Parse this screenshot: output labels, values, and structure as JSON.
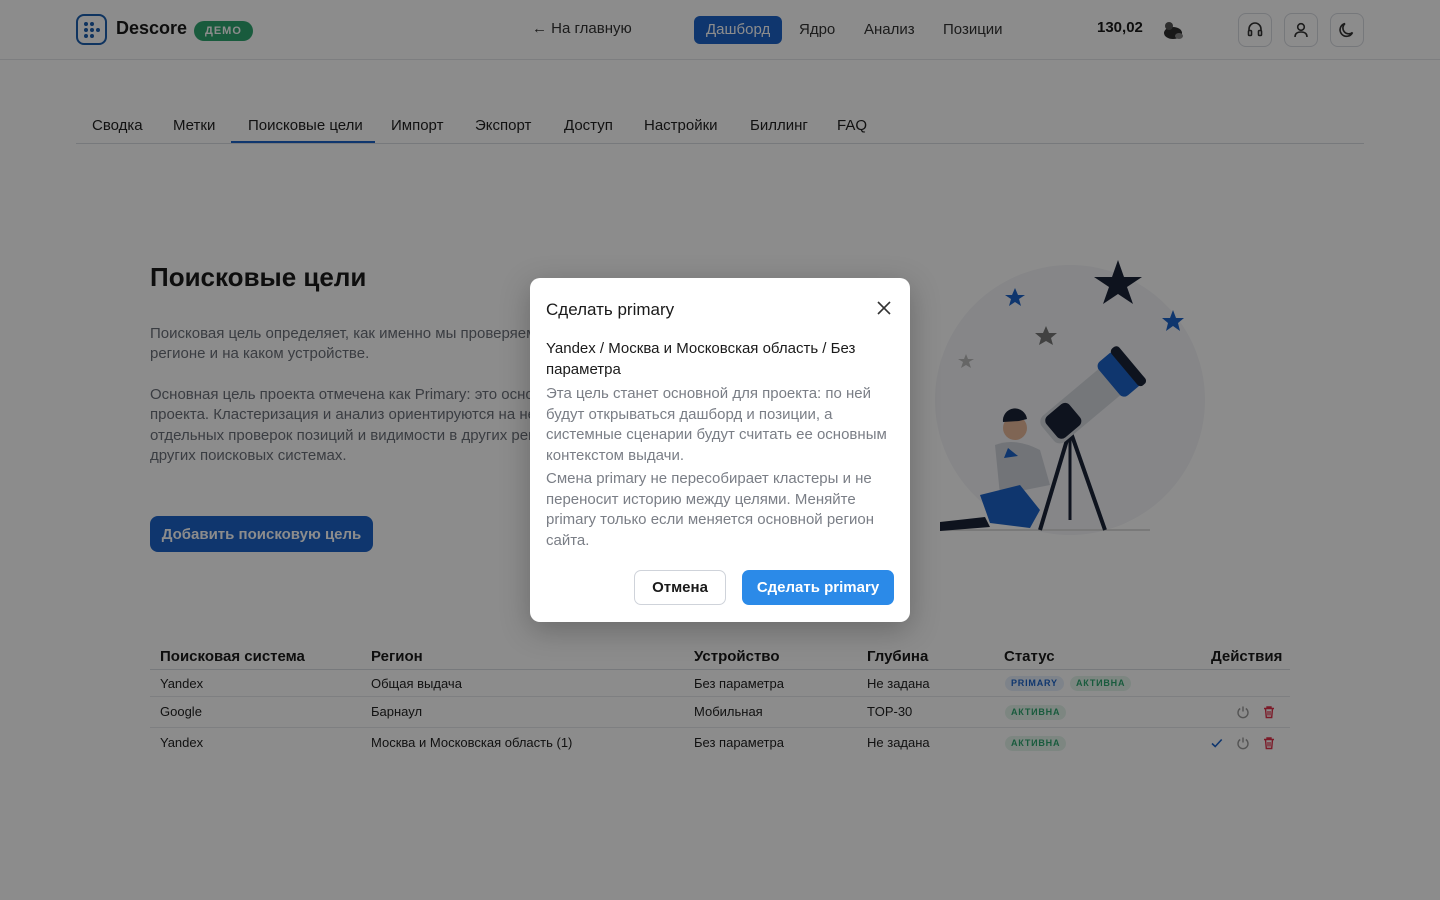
{
  "header": {
    "brand": "Descore",
    "demo_badge": "ДЕМО",
    "back_link": "← На главную",
    "nav": [
      "Дашборд",
      "Ядро",
      "Анализ",
      "Позиции"
    ],
    "balance": "130,02"
  },
  "tabs": [
    "Сводка",
    "Метки",
    "Поисковые цели",
    "Импорт",
    "Экспорт",
    "Доступ",
    "Настройки",
    "Биллинг",
    "FAQ"
  ],
  "hero": {
    "title": "Поисковые цели",
    "desc1_line1": "Поисковая цель определяет, как именно мы проверяем",
    "desc1_line2": "регионе и на каком устройстве.",
    "desc2_line1": "Основная цель проекта отмечена как Primary: это основ",
    "desc2_line2": "проекта. Кластеризация и анализ ориентируются на неё",
    "desc2_line3": "отдельных проверок позиций и видимости в других рег",
    "desc2_line4": "других поисковых системах.",
    "add_button": "Добавить поисковую цель"
  },
  "table": {
    "headers": [
      "Поисковая система",
      "Регион",
      "Устройство",
      "Глубина",
      "Статус",
      "Действия"
    ],
    "rows": [
      {
        "engine": "Yandex",
        "region": "Общая выдача",
        "device": "Без параметра",
        "depth": "Не задана",
        "badges": [
          "PRIMARY",
          "АКТИВНА"
        ]
      },
      {
        "engine": "Google",
        "region": "Барнаул",
        "device": "Мобильная",
        "depth": "TOP-30",
        "badges": [
          "АКТИВНА"
        ]
      },
      {
        "engine": "Yandex",
        "region": "Москва и Московская область (1)",
        "device": "Без параметра",
        "depth": "Не задана",
        "badges": [
          "АКТИВНА"
        ]
      }
    ]
  },
  "modal": {
    "title": "Сделать primary",
    "target_line1": "Yandex / Москва и Московская область / Без",
    "target_line2": "параметра",
    "text1": "Эта цель станет основной для проекта: по ней будут открываться дашборд и позиции, а системные сценарии будут считать ее основным контекстом выдачи.",
    "text2": "Смена primary не пересобирает кластеры и не переносит историю между целями. Меняйте primary только если меняется основной регион сайта.",
    "cancel": "Отмена",
    "confirm": "Сделать primary"
  },
  "colors": {
    "accent": "#1c63c9",
    "confirm": "#2b8ae8",
    "success": "#2ea66f",
    "danger": "#e0314a"
  }
}
